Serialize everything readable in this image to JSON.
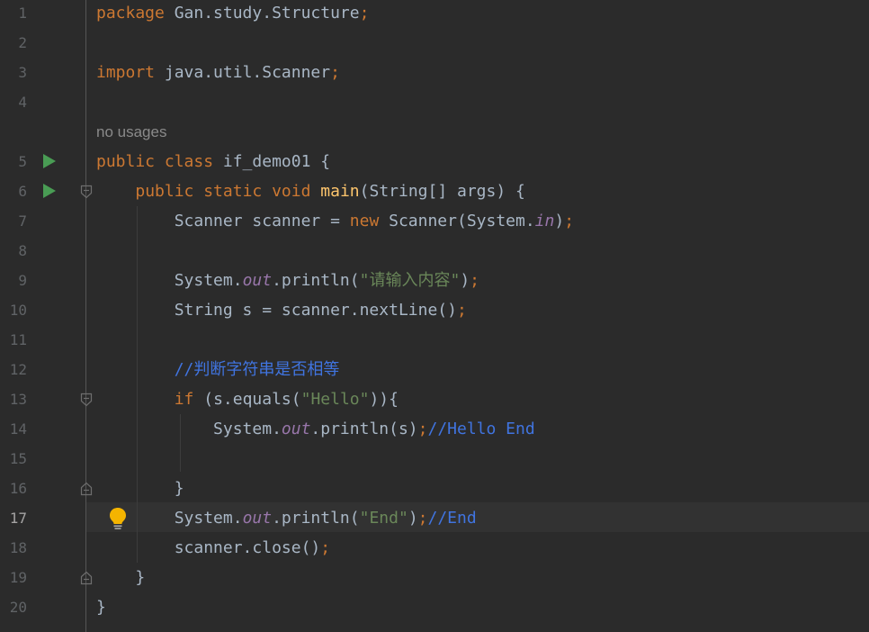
{
  "editor": {
    "language": "java",
    "current_line": "17",
    "inlay_hint": "no usages",
    "lines": [
      {
        "num": "1",
        "segments": [
          {
            "t": "package",
            "c": "kw"
          },
          {
            "t": " Gan.study.Structure",
            "c": "plain"
          },
          {
            "t": ";",
            "c": "semi"
          }
        ]
      },
      {
        "num": "2",
        "segments": []
      },
      {
        "num": "3",
        "segments": [
          {
            "t": "import",
            "c": "kw"
          },
          {
            "t": " java.util.Scanner",
            "c": "plain"
          },
          {
            "t": ";",
            "c": "semi"
          }
        ]
      },
      {
        "num": "4",
        "segments": []
      },
      {
        "num": "5",
        "segments": [
          {
            "t": "public class",
            "c": "kw"
          },
          {
            "t": " if_demo01 {",
            "c": "plain"
          }
        ]
      },
      {
        "num": "6",
        "segments": [
          {
            "t": "    "
          },
          {
            "t": "public static void",
            "c": "kw"
          },
          {
            "t": " "
          },
          {
            "t": "main",
            "c": "fn"
          },
          {
            "t": "(String[] args) {",
            "c": "plain"
          }
        ]
      },
      {
        "num": "7",
        "segments": [
          {
            "t": "        Scanner scanner = ",
            "c": "plain"
          },
          {
            "t": "new",
            "c": "kw"
          },
          {
            "t": " Scanner(System.",
            "c": "plain"
          },
          {
            "t": "in",
            "c": "fld"
          },
          {
            "t": ")",
            "c": "plain"
          },
          {
            "t": ";",
            "c": "semi"
          }
        ]
      },
      {
        "num": "8",
        "segments": []
      },
      {
        "num": "9",
        "segments": [
          {
            "t": "        System.",
            "c": "plain"
          },
          {
            "t": "out",
            "c": "fld"
          },
          {
            "t": ".println(",
            "c": "plain"
          },
          {
            "t": "\"请输入内容\"",
            "c": "str"
          },
          {
            "t": ")",
            "c": "plain"
          },
          {
            "t": ";",
            "c": "semi"
          }
        ]
      },
      {
        "num": "10",
        "segments": [
          {
            "t": "        String s = scanner.nextLine()",
            "c": "plain"
          },
          {
            "t": ";",
            "c": "semi"
          }
        ]
      },
      {
        "num": "11",
        "segments": []
      },
      {
        "num": "12",
        "segments": [
          {
            "t": "        //判断字符串是否相等",
            "c": "cmt"
          }
        ]
      },
      {
        "num": "13",
        "segments": [
          {
            "t": "        "
          },
          {
            "t": "if",
            "c": "kw"
          },
          {
            "t": " (s.equals(",
            "c": "plain"
          },
          {
            "t": "\"Hello\"",
            "c": "str"
          },
          {
            "t": ")){",
            "c": "plain"
          }
        ]
      },
      {
        "num": "14",
        "segments": [
          {
            "t": "            System.",
            "c": "plain"
          },
          {
            "t": "out",
            "c": "fld"
          },
          {
            "t": ".println(s)",
            "c": "plain"
          },
          {
            "t": ";",
            "c": "semi"
          },
          {
            "t": "//Hello End",
            "c": "cmt"
          }
        ]
      },
      {
        "num": "15",
        "segments": []
      },
      {
        "num": "16",
        "segments": [
          {
            "t": "        }",
            "c": "plain"
          }
        ]
      },
      {
        "num": "17",
        "segments": [
          {
            "t": "        System.",
            "c": "plain"
          },
          {
            "t": "out",
            "c": "fld"
          },
          {
            "t": ".println(",
            "c": "plain"
          },
          {
            "t": "\"End\"",
            "c": "str"
          },
          {
            "t": ")",
            "c": "plain"
          },
          {
            "t": ";",
            "c": "semi"
          },
          {
            "t": "//End",
            "c": "cmt"
          }
        ]
      },
      {
        "num": "18",
        "segments": [
          {
            "t": "        scanner.close()",
            "c": "plain"
          },
          {
            "t": ";",
            "c": "semi"
          }
        ]
      },
      {
        "num": "19",
        "segments": [
          {
            "t": "    }",
            "c": "plain"
          }
        ]
      },
      {
        "num": "20",
        "segments": [
          {
            "t": "}",
            "c": "plain"
          }
        ]
      }
    ]
  },
  "icons": {
    "run": "run-gutter-icon",
    "fold_start": "fold-start-icon",
    "fold_end": "fold-end-icon",
    "intention": "lightbulb-icon"
  },
  "colors": {
    "background": "#2b2b2b",
    "keyword": "#cc7832",
    "string": "#6a8759",
    "static_field": "#9876aa",
    "method_decl": "#ffc66d",
    "comment": "#4074e0",
    "text": "#a9b7c6",
    "line_number": "#606366",
    "run_icon": "#499c54",
    "bulb": "#f4b400"
  }
}
